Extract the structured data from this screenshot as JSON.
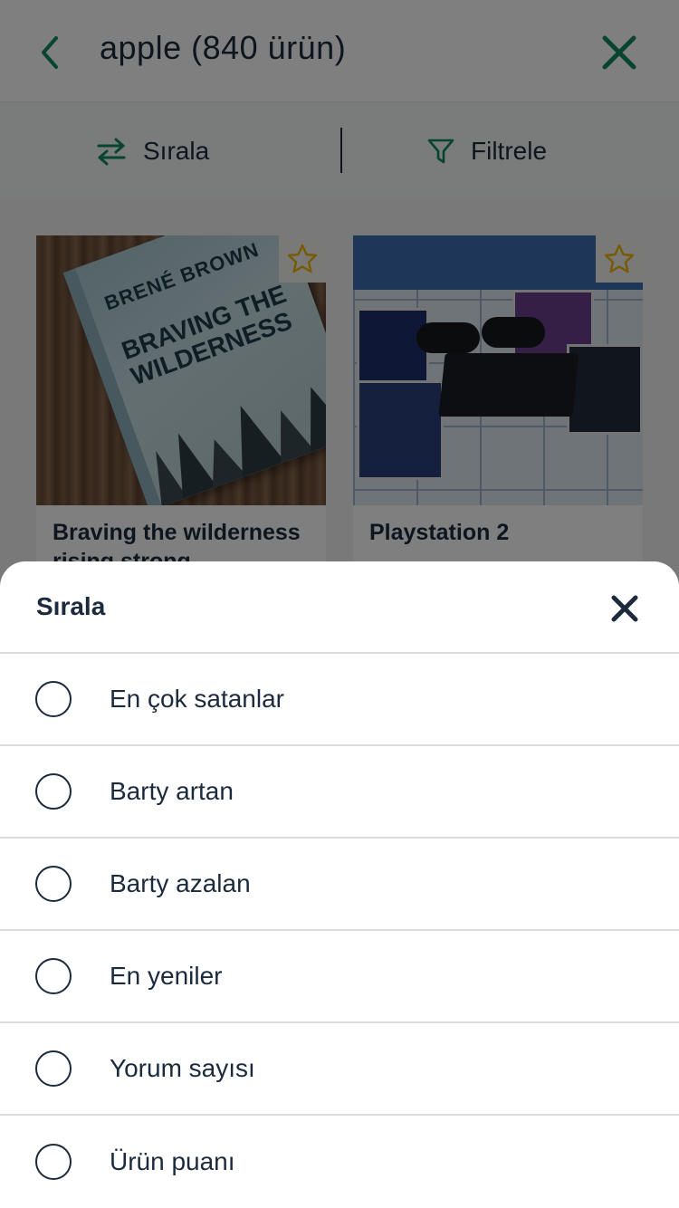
{
  "header": {
    "search_title": "apple (840 ürün)"
  },
  "toolbar": {
    "sort_label": "Sırala",
    "filter_label": "Filtrele"
  },
  "products": [
    {
      "title": "Braving the wilderness rising strong",
      "favorite_icon": "star-outline-icon"
    },
    {
      "title": "Playstation 2",
      "favorite_icon": "star-outline-icon"
    }
  ],
  "book_cover": {
    "author": "BRENÉ BROWN",
    "title_line1": "BRAVING THE",
    "title_line2": "WILDERNESS"
  },
  "sort_sheet": {
    "title": "Sırala",
    "options": [
      {
        "label": "En çok satanlar",
        "selected": false
      },
      {
        "label": "Barty artan",
        "selected": false
      },
      {
        "label": "Barty azalan",
        "selected": false
      },
      {
        "label": "En yeniler",
        "selected": false
      },
      {
        "label": "Yorum sayısı",
        "selected": false
      },
      {
        "label": "Ürün puanı",
        "selected": false
      }
    ]
  },
  "colors": {
    "accent_green": "#0f8a5f",
    "text_dark": "#1b2a3d",
    "star_yellow": "#f0b400",
    "overlay": "rgba(0,0,0,0.5)"
  }
}
